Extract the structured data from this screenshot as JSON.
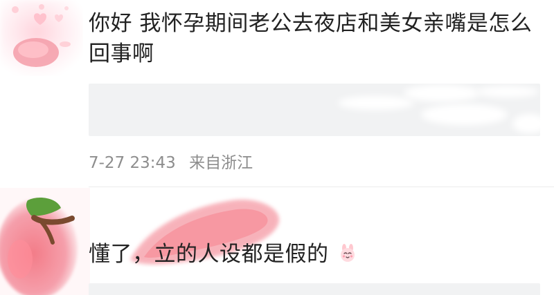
{
  "comments": [
    {
      "text": "你好 我怀孕期间老公去夜店和美女亲嘴是怎么回事啊",
      "time": "7-27 23:43",
      "location": "来自浙江"
    },
    {
      "text": "懂了，立的人设都是假的"
    }
  ],
  "colors": {
    "text": "#222222",
    "meta": "#8d8d8d",
    "reply_bg": "#f1f2f3",
    "divider": "#ececec",
    "avatar_pink": "#f07c86",
    "leaf_green": "#5c9f3b",
    "stem_brown": "#7a4a2f"
  },
  "icons": {
    "emoji": "bunny-smile-icon"
  }
}
